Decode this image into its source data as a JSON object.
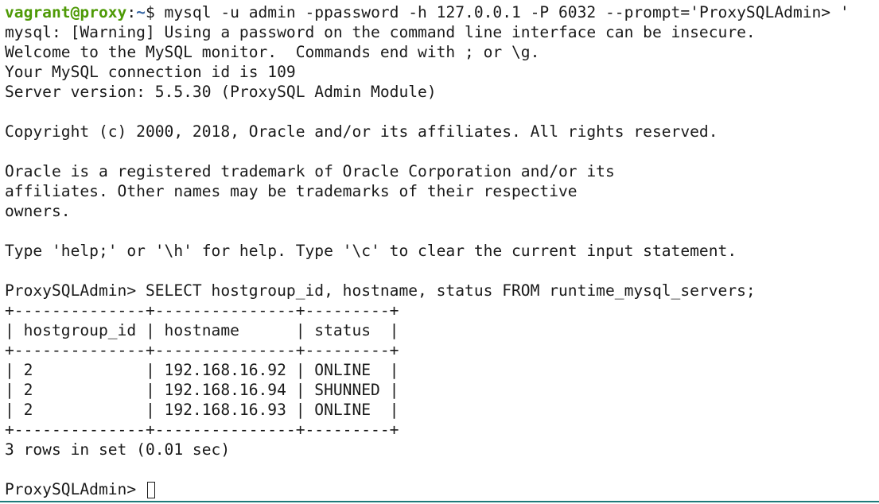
{
  "prompt": {
    "user_host": "vagrant@proxy",
    "separator": ":",
    "path": "~",
    "symbol": "$ ",
    "command": "mysql -u admin -ppassword -h 127.0.0.1 -P 6032 --prompt='ProxySQLAdmin> '"
  },
  "output": [
    "mysql: [Warning] Using a password on the command line interface can be insecure.",
    "Welcome to the MySQL monitor.  Commands end with ; or \\g.",
    "Your MySQL connection id is 109",
    "Server version: 5.5.30 (ProxySQL Admin Module)",
    "",
    "Copyright (c) 2000, 2018, Oracle and/or its affiliates. All rights reserved.",
    "",
    "Oracle is a registered trademark of Oracle Corporation and/or its",
    "affiliates. Other names may be trademarks of their respective",
    "owners.",
    "",
    "Type 'help;' or '\\h' for help. Type '\\c' to clear the current input statement.",
    ""
  ],
  "query": "ProxySQLAdmin> SELECT hostgroup_id, hostname, status FROM runtime_mysql_servers;",
  "table": {
    "border": "+--------------+---------------+---------+",
    "header": "| hostgroup_id | hostname      | status  |",
    "rows": [
      "| 2            | 192.168.16.92 | ONLINE  |",
      "| 2            | 192.168.16.94 | SHUNNED |",
      "| 2            | 192.168.16.93 | ONLINE  |"
    ]
  },
  "result_summary": "3 rows in set (0.01 sec)",
  "final_prompt": "ProxySQLAdmin> ",
  "colors": {
    "user_host": "#4e9a06",
    "path": "#3465a4",
    "text": "#1a1a1a",
    "background": "#ffffff"
  }
}
